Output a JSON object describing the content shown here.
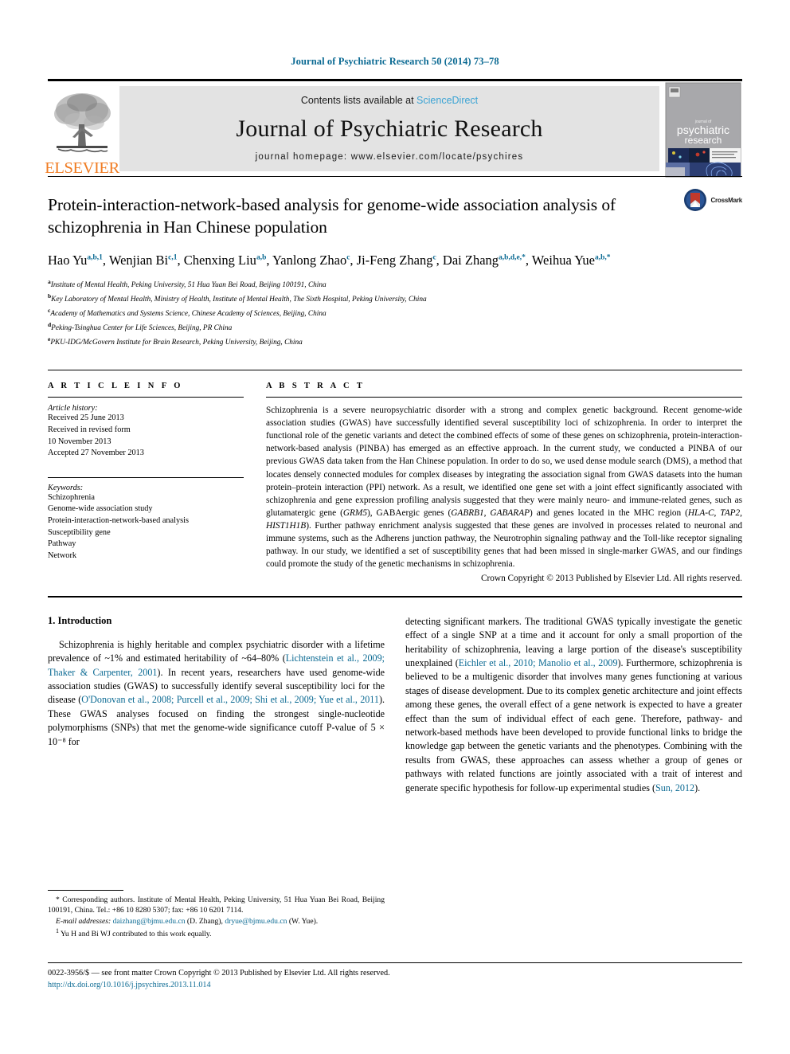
{
  "running_head": "Journal of Psychiatric Research 50 (2014) 73–78",
  "masthead": {
    "publisher": "ELSEVIER",
    "contents_prefix": "Contents lists available at ",
    "contents_link": "ScienceDirect",
    "journal_title": "Journal of Psychiatric Research",
    "homepage": "journal homepage: www.elsevier.com/locate/psychires",
    "cover_title_line1": "psychiatric",
    "cover_title_line2": "research",
    "cover_kicker": "journal of"
  },
  "crossmark": {
    "label": "CrossMark"
  },
  "article": {
    "title": "Protein-interaction-network-based analysis for genome-wide association analysis of schizophrenia in Han Chinese population",
    "authors": [
      {
        "name": "Hao Yu",
        "sup": "a,b,1",
        "sep": ", "
      },
      {
        "name": "Wenjian Bi",
        "sup": "c,1",
        "sep": ", "
      },
      {
        "name": "Chenxing Liu",
        "sup": "a,b",
        "sep": ", "
      },
      {
        "name": "Yanlong Zhao",
        "sup": "c",
        "sep": ", "
      },
      {
        "name": "Ji-Feng Zhang",
        "sup": "c",
        "sep": ", "
      },
      {
        "name": "Dai Zhang",
        "sup": "a,b,d,e,*",
        "sep": ", "
      },
      {
        "name": "Weihua Yue",
        "sup": "a,b,*",
        "sep": ""
      }
    ],
    "affiliations": [
      {
        "key": "a",
        "text": "Institute of Mental Health, Peking University, 51 Hua Yuan Bei Road, Beijing 100191, China"
      },
      {
        "key": "b",
        "text": "Key Laboratory of Mental Health, Ministry of Health, Institute of Mental Health, The Sixth Hospital, Peking University, China"
      },
      {
        "key": "c",
        "text": "Academy of Mathematics and Systems Science, Chinese Academy of Sciences, Beijing, China"
      },
      {
        "key": "d",
        "text": "Peking-Tsinghua Center for Life Sciences, Beijing, PR China"
      },
      {
        "key": "e",
        "text": "PKU-IDG/McGovern Institute for Brain Research, Peking University, Beijing, China"
      }
    ]
  },
  "article_info": {
    "heading": "A R T I C L E  I N F O",
    "history_label": "Article history:",
    "history": [
      "Received 25 June 2013",
      "Received in revised form",
      "10 November 2013",
      "Accepted 27 November 2013"
    ],
    "keywords_label": "Keywords:",
    "keywords": [
      "Schizophrenia",
      "Genome-wide association study",
      "Protein-interaction-network-based analysis",
      "Susceptibility gene",
      "Pathway",
      "Network"
    ]
  },
  "abstract": {
    "heading": "A B S T R A C T",
    "text_parts": [
      {
        "t": "Schizophrenia is a severe neuropsychiatric disorder with a strong and complex genetic background. Recent genome-wide association studies (GWAS) have successfully identified several susceptibility loci of schizophrenia. In order to interpret the functional role of the genetic variants and detect the combined effects of some of these genes on schizophrenia, protein-interaction-network-based analysis (PINBA) has emerged as an effective approach. In the current study, we conducted a PINBA of our previous GWAS data taken from the Han Chinese population. In order to do so, we used dense module search (DMS), a method that locates densely connected modules for complex diseases by integrating the association signal from GWAS datasets into the human protein–protein interaction (PPI) network. As a result, we identified one gene set with a joint effect significantly associated with schizophrenia and gene expression profiling analysis suggested that they were mainly neuro- and immune-related genes, such as glutamatergic gene (",
        "i": false
      },
      {
        "t": "GRM5",
        "i": true
      },
      {
        "t": "), GABAergic genes (",
        "i": false
      },
      {
        "t": "GABRB1, GABARAP",
        "i": true
      },
      {
        "t": ") and genes located in the MHC region (",
        "i": false
      },
      {
        "t": "HLA-C, TAP2, HIST1H1B",
        "i": true
      },
      {
        "t": "). Further pathway enrichment analysis suggested that these genes are involved in processes related to neuronal and immune systems, such as the Adherens junction pathway, the Neurotrophin signaling pathway and the Toll-like receptor signaling pathway. In our study, we identified a set of susceptibility genes that had been missed in single-marker GWAS, and our findings could promote the study of the genetic mechanisms in schizophrenia.",
        "i": false
      }
    ],
    "copyright": "Crown Copyright © 2013 Published by Elsevier Ltd. All rights reserved."
  },
  "intro": {
    "heading": "1. Introduction",
    "left_parts": [
      {
        "t": "Schizophrenia is highly heritable and complex psychiatric disorder with a lifetime prevalence of ~1% and estimated heritability of ~64–80% (",
        "c": false
      },
      {
        "t": "Lichtenstein et al., 2009; Thaker & Carpenter, 2001",
        "c": true
      },
      {
        "t": "). In recent years, researchers have used genome-wide association studies (GWAS) to successfully identify several susceptibility loci for the disease (",
        "c": false
      },
      {
        "t": "O'Donovan et al., 2008; Purcell et al., 2009; Shi et al., 2009; Yue et al., 2011",
        "c": true
      },
      {
        "t": "). These GWAS analyses focused on finding the strongest single-nucleotide polymorphisms (SNPs) that met the genome-wide significance cutoff P-value of 5 × 10⁻⁸ for",
        "c": false
      }
    ],
    "right_parts": [
      {
        "t": "detecting significant markers. The traditional GWAS typically investigate the genetic effect of a single SNP at a time and it account for only a small proportion of the heritability of schizophrenia, leaving a large portion of the disease's susceptibility unexplained (",
        "c": false
      },
      {
        "t": "Eichler et al., 2010; Manolio et al., 2009",
        "c": true
      },
      {
        "t": "). Furthermore, schizophrenia is believed to be a multigenic disorder that involves many genes functioning at various stages of disease development. Due to its complex genetic architecture and joint effects among these genes, the overall effect of a gene network is expected to have a greater effect than the sum of individual effect of each gene. Therefore, pathway- and network-based methods have been developed to provide functional links to bridge the knowledge gap between the genetic variants and the phenotypes. Combining with the results from GWAS, these approaches can assess whether a group of genes or pathways with related functions are jointly associated with a trait of interest and generate specific hypothesis for follow-up experimental studies (",
        "c": false
      },
      {
        "t": "Sun, 2012",
        "c": true
      },
      {
        "t": ").",
        "c": false
      }
    ]
  },
  "footnotes": {
    "corresponding": "* Corresponding authors. Institute of Mental Health, Peking University, 51 Hua Yuan Bei Road, Beijing 100191, China. Tel.: +86 10 8280 5307; fax: +86 10 6201 7114.",
    "email_label": "E-mail addresses:",
    "email1": "daizhang@bjmu.edu.cn",
    "email1_owner": "(D. Zhang)",
    "email2": "dryue@bjmu.edu.cn",
    "email2_owner": "(W. Yue).",
    "equal_contrib_marker": "1",
    "equal_contrib": "Yu H and Bi WJ contributed to this work equally."
  },
  "bottom": {
    "issn_line": "0022-3956/$ — see front matter Crown Copyright © 2013 Published by Elsevier Ltd. All rights reserved.",
    "doi": "http://dx.doi.org/10.1016/j.jpsychires.2013.11.014"
  },
  "colors": {
    "link_blue": "#0b6a93",
    "sciencedirect_blue": "#3aa3d4",
    "elsevier_orange": "#f07c22",
    "banner_gray": "#e3e3e3"
  }
}
